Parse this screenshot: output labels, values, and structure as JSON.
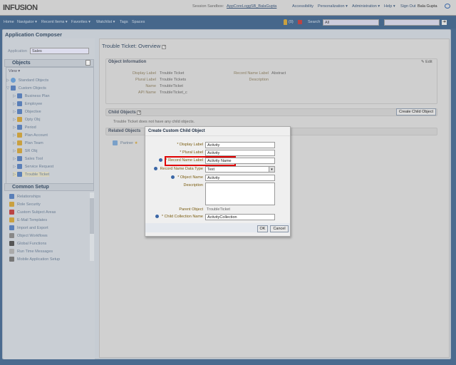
{
  "header": {
    "logo": "INFUSION",
    "session_label": "Session Sandbox:",
    "session_value": "AppCoreLoggSB_BalaGupta",
    "links": [
      "Accessibility",
      "Personalization ▾",
      "Administration ▾",
      "Help ▾",
      "Sign Out"
    ],
    "user": "Bala Gupta"
  },
  "nav": {
    "items": [
      "Home",
      "Navigator ▾",
      "Recent Items ▾",
      "Favorites ▾",
      "Watchlist ▾",
      "Tags",
      "Spaces"
    ],
    "notifications": "(0)",
    "search_label": "Search",
    "search_scope": "All",
    "search_value": ""
  },
  "composer": {
    "title": "Application Composer",
    "application_label": "Application",
    "application_value": "Sales"
  },
  "objects": {
    "title": "Objects",
    "view": "View ▾",
    "standard": "Standard Objects",
    "custom": "Custom Objects",
    "items": [
      "Business Plan",
      "Employee",
      "Objective",
      "Opty Obj",
      "Period",
      "Plan Account",
      "Plan Team",
      "SR Obj",
      "Sales Tool",
      "Service Request",
      "Trouble Ticket"
    ]
  },
  "common_setup": {
    "title": "Common Setup",
    "items": [
      "Relationships",
      "Role Security",
      "Custom Subject Areas",
      "E-Mail Templates",
      "Import and Export",
      "Object Workflows",
      "Global Functions",
      "Run Time Messages",
      "Mobile Application Setup"
    ]
  },
  "overview": {
    "title": "Trouble Ticket: Overview",
    "object_info": "Object Information",
    "edit": "Edit",
    "fields": [
      {
        "label": "Display Label",
        "value": "Trouble Ticket"
      },
      {
        "label": "Plural Label",
        "value": "Trouble Tickets"
      },
      {
        "label": "Name",
        "value": "TroubleTicket"
      },
      {
        "label": "API Name",
        "value": "TroubleTicket_c"
      }
    ],
    "record_name_label": "Record Name Label",
    "record_name_value": "Abstract",
    "description_label": "Description",
    "child_objects": "Child Objects",
    "create_child": "Create Child Object",
    "no_children": "Trouble Ticket does not have any child objects.",
    "related_objects": "Related Objects",
    "partner": "Partner"
  },
  "dialog": {
    "title": "Create Custom Child Object",
    "display_label": "* Display Label",
    "display_value": "Activity",
    "plural_label": "* Plural Label",
    "plural_value": "Activity",
    "record_name_label": "* Record Name Label",
    "record_name_value": "Activity Name",
    "record_type_label": "Record Name Data Type",
    "record_type_value": "Text",
    "object_name_label": "* Object Name",
    "object_name_value": "Activity",
    "description_label": "Description",
    "description_value": "",
    "parent_label": "Parent Object",
    "parent_value": "TroubleTicket",
    "collection_label": "* Child Collection Name",
    "collection_value": "ActivityCollection",
    "ok": "OK",
    "cancel": "Cancel"
  },
  "colors": {
    "highlight": "#e00000",
    "nav": "#46678b"
  }
}
